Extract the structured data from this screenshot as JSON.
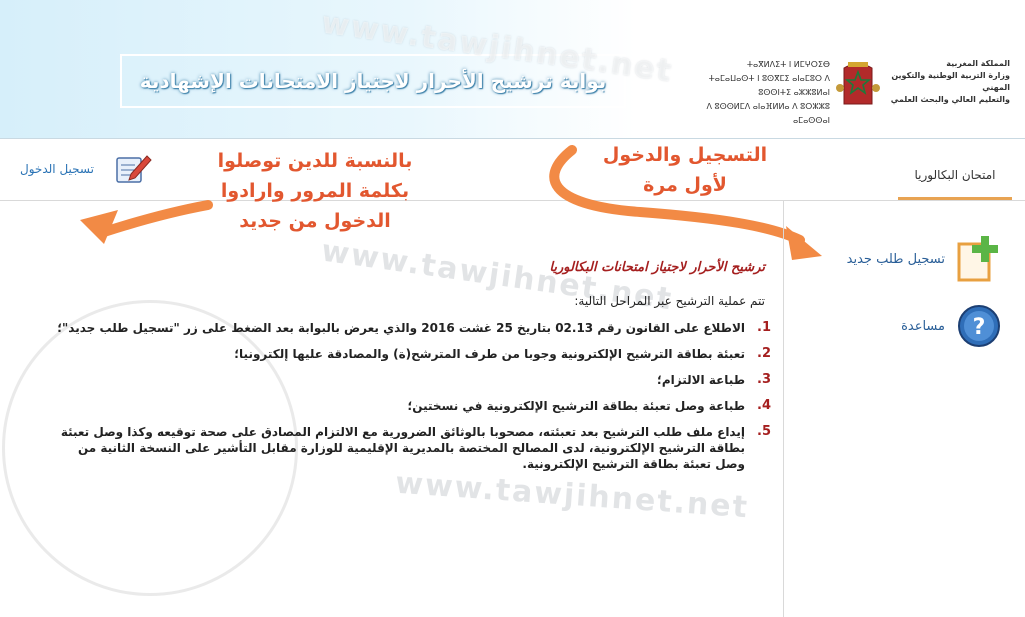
{
  "header": {
    "portal_title": "بوابة ترشيح الأحرار لاجتياز الامتحانات الإشهادية",
    "ministry_lines": [
      "المملكة المغربية",
      "وزارة التربية الوطنية والتكوين المهني",
      "والتعليم العالي والبحث العلمي"
    ],
    "tifinagh_lines": [
      "ⵜⴰⴳⵍⴷⵉⵜ ⵏ ⵍⵎⵖⵔⵉⴱ",
      "ⵜⴰⵎⴰⵡⴰⵙⵜ ⵏ ⵓⵙⴳⵎⵉ ⴰⵏⴰⵎⵓⵔ ⴷ ⵓⵙⵙⵏⵜⵉ ⴰⵣⵣⵓⵍⴰⵏ",
      "ⴷ ⵓⵙⵙⵍⵎⴷ ⴰⵏⴰⴼⵍⵍⴰ ⴷ ⵓⵔⵣⵣⵓ ⴰⵎⴰⵙⵙⴰⵏ"
    ]
  },
  "tabs": {
    "bac": "امتحان البكالوريا",
    "login": "تسجيل الدخول"
  },
  "annotations": {
    "left": [
      "بالنسبة للدين توصلوا",
      "بكلمة المرور وارادوا",
      "الدخول من جديد"
    ],
    "right": [
      "التسجيل والدخول",
      "لأول مرة"
    ]
  },
  "watermark": "www.tawjihnet.net",
  "main": {
    "title": "ترشيح الأحرار لاجتياز امتحانات البكالوريا",
    "intro": "تتم عملية الترشيح عبر المراحل التالية:",
    "steps": [
      {
        "num": "1.",
        "text": "الاطلاع على القانون رقم 02.13 بتاريخ 25 غشت 2016 والذي يعرض بالبوابة بعد الضغط على زر \"تسجيل طلب جديد\"؛"
      },
      {
        "num": "2.",
        "text": "تعبئة بطاقة الترشيح الإلكترونية وجوبا من طرف المترشح(ة) والمصادقة عليها إلكترونيا؛"
      },
      {
        "num": "3.",
        "text": "طباعة الالتزام؛"
      },
      {
        "num": "4.",
        "text": "طباعة وصل تعبئة بطاقة الترشيح الإلكترونية في نسختين؛"
      },
      {
        "num": "5.",
        "text": "إيداع ملف طلب الترشيح بعد تعبئته، مصحوبا بالوثائق الضرورية مع الالتزام المصادق على صحة توقيعه وكذا وصل تعبئة بطاقة الترشيح الإلكترونية، لدى المصالح المختصة بالمديرية الإقليمية للوزارة مقابل التأشير على النسخة الثانية من وصل تعبئة بطاقة الترشيح الإلكترونية."
      }
    ]
  },
  "sidebar": {
    "new_application": "تسجيل طلب جديد",
    "help": "مساعدة"
  },
  "colors": {
    "accent_red": "#a51f1f",
    "annotation_orange": "#e2572f",
    "link_blue": "#2a73b5",
    "tab_underline": "#e8a352"
  }
}
